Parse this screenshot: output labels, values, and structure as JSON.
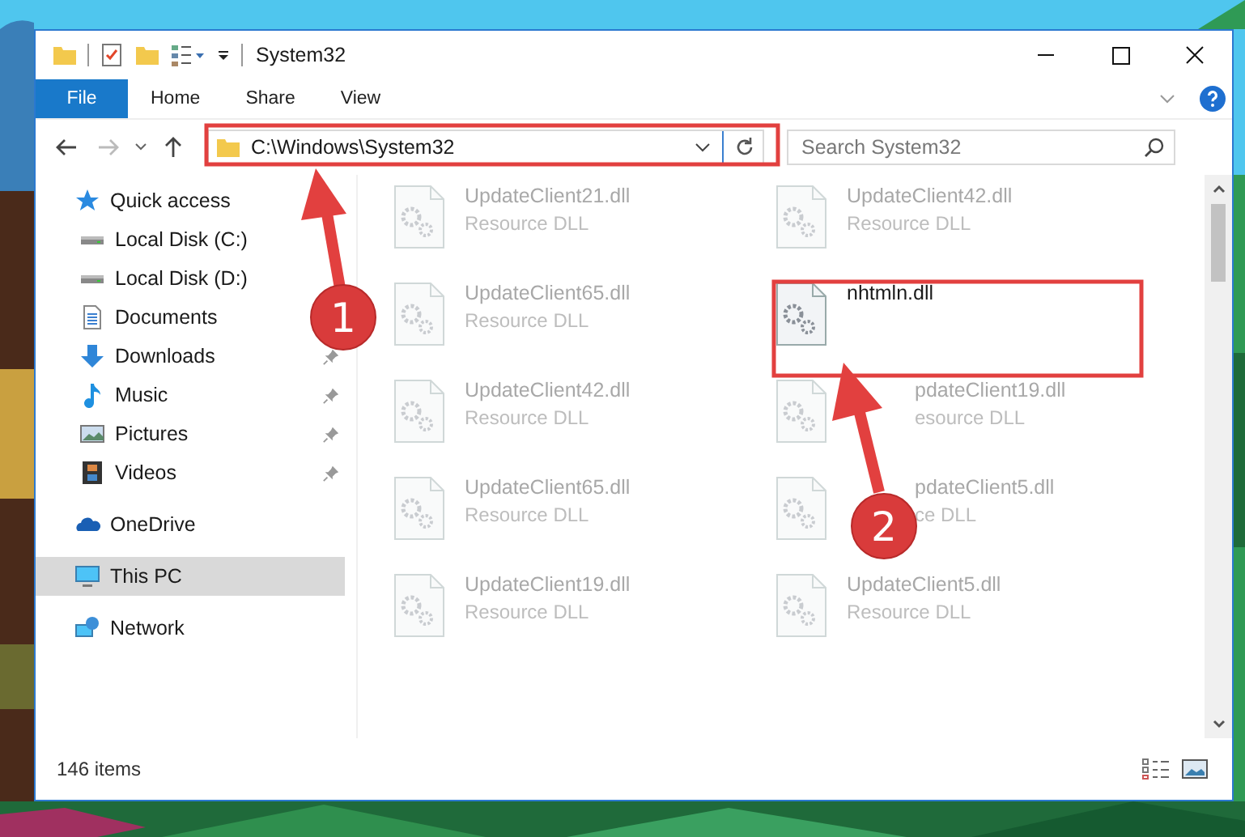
{
  "window": {
    "title": "System32"
  },
  "ribbon_tabs": [
    {
      "label": "File",
      "kind": "file"
    },
    {
      "label": "Home",
      "kind": "tab"
    },
    {
      "label": "Share",
      "kind": "tab"
    },
    {
      "label": "View",
      "kind": "tab"
    }
  ],
  "address_bar": {
    "path": "C:\\Windows\\System32"
  },
  "search": {
    "placeholder": "Search System32"
  },
  "navigation": [
    {
      "label": "Quick access",
      "kind": "star",
      "selected": false,
      "children": [
        {
          "label": "Local Disk (C:)",
          "kind": "drive"
        },
        {
          "label": "Local Disk (D:)",
          "kind": "drive"
        },
        {
          "label": "Documents",
          "kind": "documents"
        },
        {
          "label": "Downloads",
          "kind": "downloads",
          "pinned": true
        },
        {
          "label": "Music",
          "kind": "music",
          "pinned": true
        },
        {
          "label": "Pictures",
          "kind": "pictures",
          "pinned": true
        },
        {
          "label": "Videos",
          "kind": "videos",
          "pinned": true
        }
      ]
    },
    {
      "label": "OneDrive",
      "kind": "cloud",
      "selected": false
    },
    {
      "label": "This PC",
      "kind": "pc",
      "selected": true
    },
    {
      "label": "Network",
      "kind": "network",
      "selected": false
    }
  ],
  "files": [
    {
      "name": "UpdateClient21.dll",
      "type": "Resource DLL",
      "dimmed": true,
      "covered": false
    },
    {
      "name": "UpdateClient42.dll",
      "type": "Resource DLL",
      "dimmed": true,
      "covered": false
    },
    {
      "name": "UpdateClient65.dll",
      "type": "Resource DLL",
      "dimmed": true,
      "covered": false
    },
    {
      "name": "nhtmln.dll",
      "dimmed": false,
      "covered": false
    },
    {
      "name": "UpdateClient42.dll",
      "type": "Resource DLL",
      "dimmed": true,
      "covered": false
    },
    {
      "name": "pdateClient19.dll",
      "type": "esource DLL",
      "dimmed": true,
      "covered": true
    },
    {
      "name": "UpdateClient65.dll",
      "type": "Resource DLL",
      "dimmed": true,
      "covered": false
    },
    {
      "name": "pdateClient5.dll",
      "type": "ce DLL",
      "dimmed": true,
      "covered": true
    },
    {
      "name": "UpdateClient19.dll",
      "type": "Resource DLL",
      "dimmed": true,
      "covered": false
    },
    {
      "name": "UpdateClient5.dll",
      "type": "Resource DLL",
      "dimmed": true,
      "covered": false
    }
  ],
  "status_bar": {
    "item_count": "146 items"
  },
  "annotations": [
    {
      "label": "1"
    },
    {
      "label": "2"
    }
  ]
}
